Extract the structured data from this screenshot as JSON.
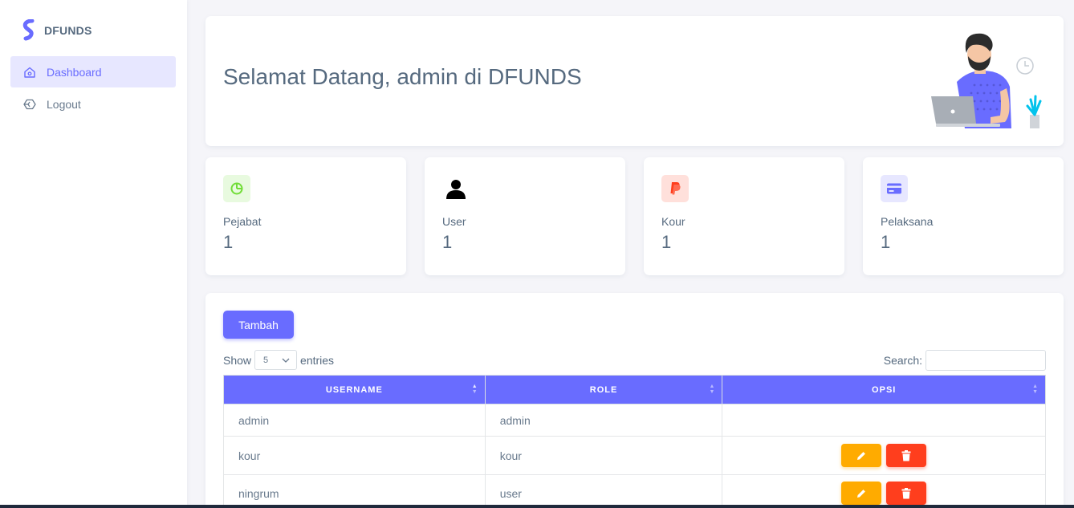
{
  "brand": {
    "name": "DFUNDS",
    "color": "#696cff"
  },
  "sidebar": {
    "items": [
      {
        "label": "Dashboard",
        "icon": "home-icon",
        "active": true
      },
      {
        "label": "Logout",
        "icon": "cube-icon",
        "active": false
      }
    ]
  },
  "welcome": {
    "title": "Selamat Datang, admin di DFUNDS"
  },
  "stats": [
    {
      "label": "Pejabat",
      "value": "1",
      "icon": "pie-chart-icon",
      "color": "#71dd37"
    },
    {
      "label": "User",
      "value": "1",
      "icon": "user-icon",
      "color": "#000000"
    },
    {
      "label": "Kour",
      "value": "1",
      "icon": "paypal-icon",
      "color": "#ff3e1d"
    },
    {
      "label": "Pelaksana",
      "value": "1",
      "icon": "credit-card-icon",
      "color": "#696cff"
    }
  ],
  "table": {
    "add_label": "Tambah",
    "show_label": "Show",
    "entries_label": "entries",
    "page_size": "5",
    "search_label": "Search:",
    "search_value": "",
    "columns": [
      "USERNAME",
      "ROLE",
      "OPSI"
    ],
    "rows": [
      {
        "username": "admin",
        "role": "admin"
      },
      {
        "username": "kour",
        "role": "kour"
      },
      {
        "username": "ningrum",
        "role": "user"
      }
    ]
  }
}
